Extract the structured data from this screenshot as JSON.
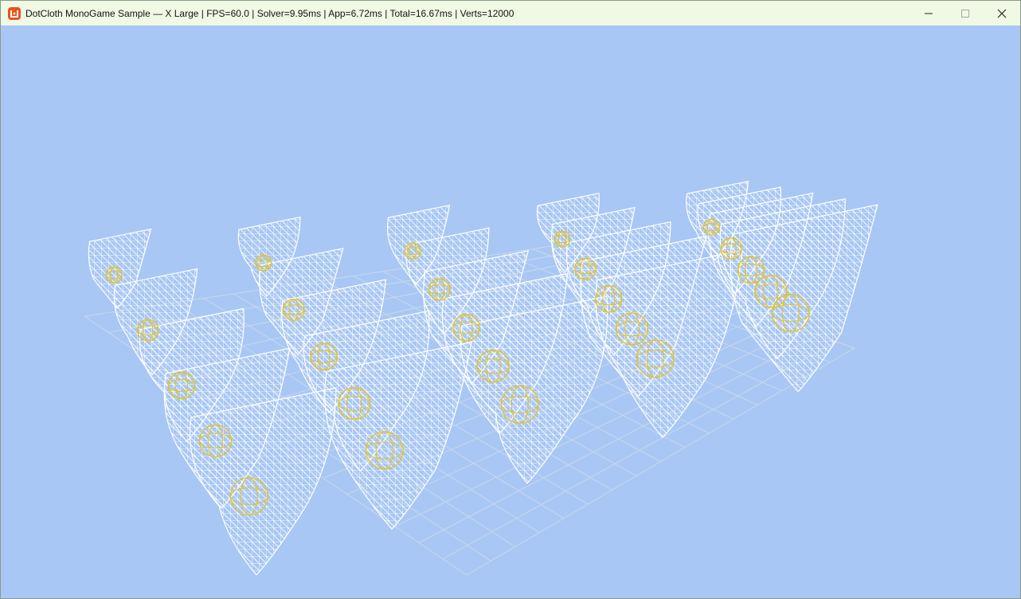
{
  "window": {
    "title": "DotCloth MonoGame Sample — X Large | FPS=60.0 | Solver=9.95ms | App=6.72ms | Total=16.67ms | Verts=12000",
    "icon": "monogame-logo-icon",
    "controls": [
      "minimize-icon",
      "maximize-icon",
      "close-icon"
    ]
  },
  "scene": {
    "background_color": "#a8c7f4",
    "cloth_color": "#ffffff",
    "collider_color": "#e8c21c",
    "grid_color": "#c8d7ec",
    "cloth_count": 25,
    "collider_count": 25
  }
}
